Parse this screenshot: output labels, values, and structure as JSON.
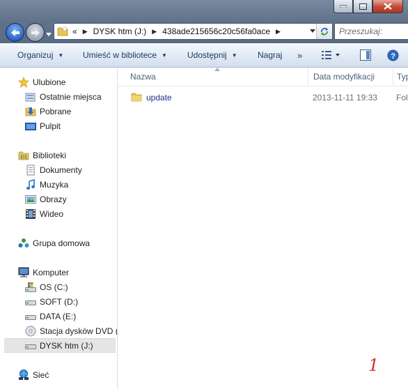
{
  "address": {
    "overflow": "«",
    "crumbs": [
      "DYSK htm (J:)",
      "438ade215656c20c56fa0ace"
    ]
  },
  "search": {
    "placeholder": "Przeszukaj:"
  },
  "toolbar": {
    "organize": "Organizuj",
    "include_library": "Umieść w bibliotece",
    "share": "Udostępnij",
    "burn": "Nagraj",
    "more": "»"
  },
  "sidebar": {
    "favorites": {
      "label": "Ulubione",
      "items": [
        {
          "label": "Ostatnie miejsca",
          "icon": "recent-places-icon"
        },
        {
          "label": "Pobrane",
          "icon": "downloads-icon"
        },
        {
          "label": "Pulpit",
          "icon": "desktop-icon"
        }
      ]
    },
    "libraries": {
      "label": "Biblioteki",
      "items": [
        {
          "label": "Dokumenty",
          "icon": "documents-icon"
        },
        {
          "label": "Muzyka",
          "icon": "music-icon"
        },
        {
          "label": "Obrazy",
          "icon": "pictures-icon"
        },
        {
          "label": "Wideo",
          "icon": "video-icon"
        }
      ]
    },
    "homegroup": {
      "label": "Grupa domowa"
    },
    "computer": {
      "label": "Komputer",
      "items": [
        {
          "label": "OS (C:)",
          "icon": "system-drive-icon"
        },
        {
          "label": "SOFT (D:)",
          "icon": "drive-icon"
        },
        {
          "label": "DATA (E:)",
          "icon": "drive-icon"
        },
        {
          "label": "Stacja dysków DVD (H",
          "icon": "dvd-drive-icon"
        },
        {
          "label": "DYSK htm (J:)",
          "icon": "drive-icon",
          "selected": true
        }
      ]
    },
    "network": {
      "label": "Sieć"
    }
  },
  "columns": {
    "name": "Nazwa",
    "modified": "Data modyfikacji",
    "type": "Typ"
  },
  "files": [
    {
      "name": "update",
      "modified": "2013-11-11 19:33",
      "type": "Fol"
    }
  ],
  "annotation": "1",
  "colors": {
    "selection": "#e5e5e5",
    "link_text": "#1c2f8c",
    "annotation": "#d92d2d"
  }
}
